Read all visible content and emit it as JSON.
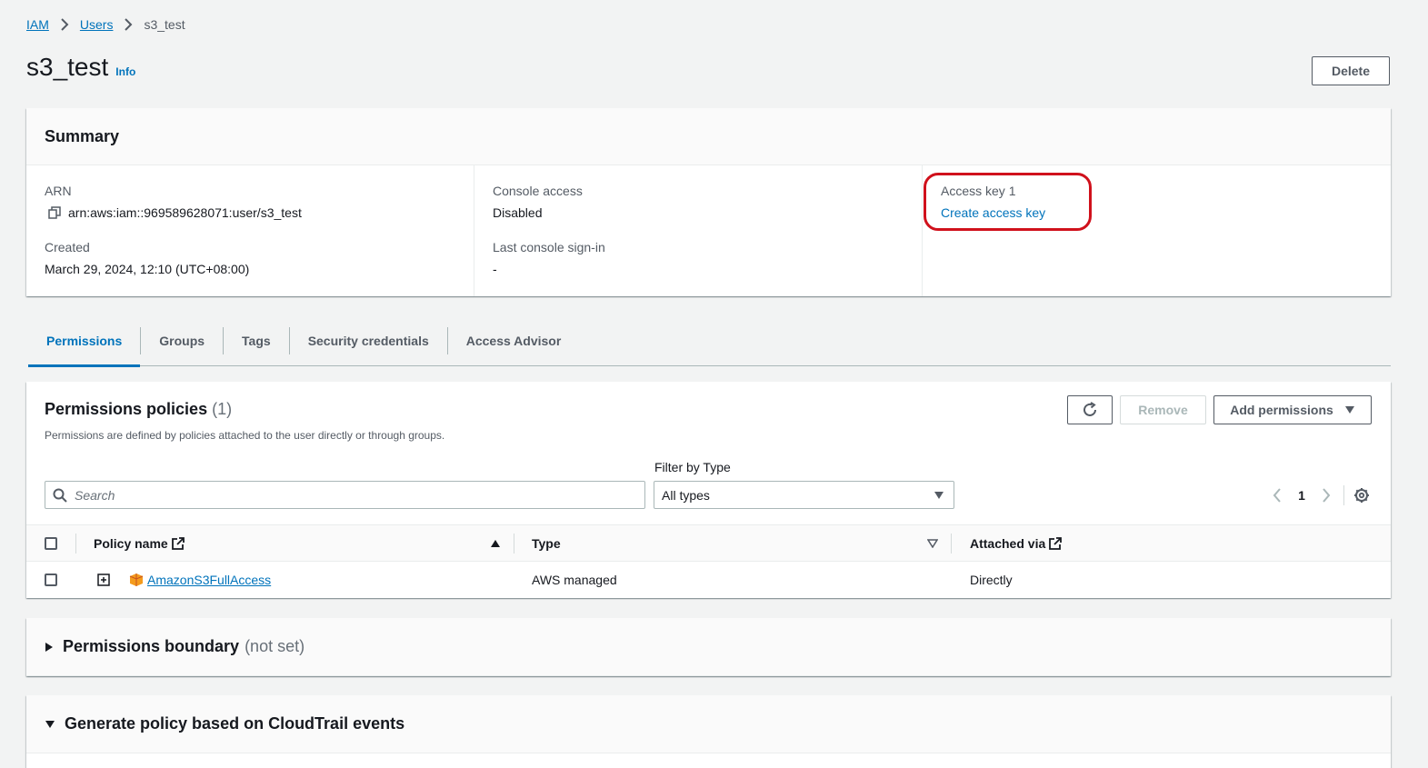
{
  "breadcrumb": {
    "root": "IAM",
    "users": "Users",
    "current": "s3_test"
  },
  "page": {
    "title": "s3_test",
    "info": "Info",
    "delete_label": "Delete"
  },
  "summary": {
    "title": "Summary",
    "arn_label": "ARN",
    "arn_value": "arn:aws:iam::969589628071:user/s3_test",
    "created_label": "Created",
    "created_value": "March 29, 2024, 12:10 (UTC+08:00)",
    "console_access_label": "Console access",
    "console_access_value": "Disabled",
    "last_signin_label": "Last console sign-in",
    "last_signin_value": "-",
    "access_key_label": "Access key 1",
    "access_key_link": "Create access key"
  },
  "tabs": [
    {
      "label": "Permissions",
      "active": true
    },
    {
      "label": "Groups"
    },
    {
      "label": "Tags"
    },
    {
      "label": "Security credentials"
    },
    {
      "label": "Access Advisor"
    }
  ],
  "policies": {
    "title": "Permissions policies",
    "count": "(1)",
    "description": "Permissions are defined by policies attached to the user directly or through groups.",
    "remove_label": "Remove",
    "add_label": "Add permissions",
    "search_placeholder": "Search",
    "filter_label": "Filter by Type",
    "filter_value": "All types",
    "page_number": "1",
    "columns": {
      "policy_name": "Policy name",
      "type": "Type",
      "attached_via": "Attached via"
    },
    "rows": [
      {
        "name": "AmazonS3FullAccess",
        "type": "AWS managed",
        "attached_via": "Directly"
      }
    ]
  },
  "boundary": {
    "title": "Permissions boundary",
    "status": "(not set)"
  },
  "cloudtrail": {
    "title": "Generate policy based on CloudTrail events"
  },
  "colors": {
    "link": "#0073bb",
    "highlight": "#d0111c",
    "aws_orange": "#f49b1d"
  }
}
